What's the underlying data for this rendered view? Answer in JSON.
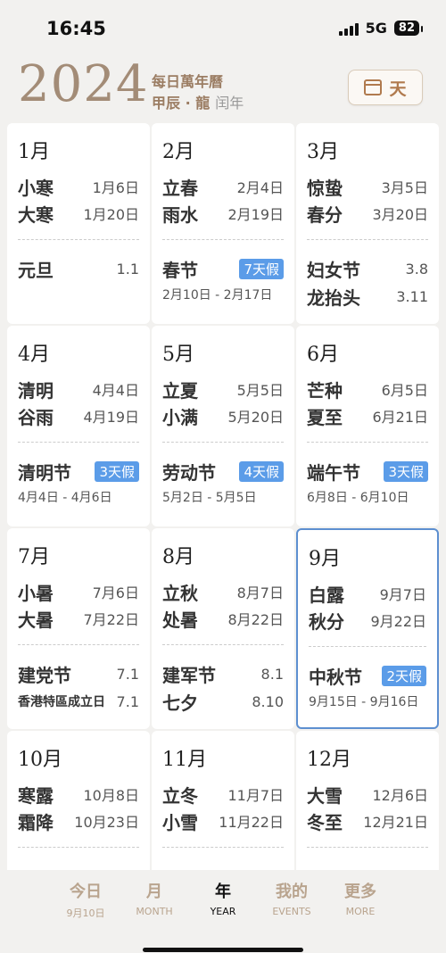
{
  "status": {
    "time": "16:45",
    "network": "5G",
    "battery": "82"
  },
  "header": {
    "year": "2024",
    "title": "每日萬年曆",
    "ganzhi": "甲辰 · 龍",
    "leap": "闰年",
    "day_button_label": "天",
    "day_button_icon": "calendar-icon"
  },
  "months": [
    {
      "month": "1月",
      "terms": [
        {
          "name": "小寒",
          "date": "1月6日"
        },
        {
          "name": "大寒",
          "date": "1月20日"
        }
      ],
      "holidays": [
        {
          "name": "元旦",
          "value": "1.1"
        }
      ]
    },
    {
      "month": "2月",
      "terms": [
        {
          "name": "立春",
          "date": "2月4日"
        },
        {
          "name": "雨水",
          "date": "2月19日"
        }
      ],
      "holidays": [
        {
          "name": "春节",
          "badge": "7天假",
          "range": "2月10日 - 2月17日"
        }
      ]
    },
    {
      "month": "3月",
      "terms": [
        {
          "name": "惊蛰",
          "date": "3月5日"
        },
        {
          "name": "春分",
          "date": "3月20日"
        }
      ],
      "holidays": [
        {
          "name": "妇女节",
          "value": "3.8"
        },
        {
          "name": "龙抬头",
          "value": "3.11"
        }
      ]
    },
    {
      "month": "4月",
      "terms": [
        {
          "name": "清明",
          "date": "4月4日"
        },
        {
          "name": "谷雨",
          "date": "4月19日"
        }
      ],
      "holidays": [
        {
          "name": "清明节",
          "badge": "3天假",
          "range": "4月4日 - 4月6日"
        }
      ]
    },
    {
      "month": "5月",
      "terms": [
        {
          "name": "立夏",
          "date": "5月5日"
        },
        {
          "name": "小满",
          "date": "5月20日"
        }
      ],
      "holidays": [
        {
          "name": "劳动节",
          "badge": "4天假",
          "range": "5月2日 - 5月5日"
        }
      ]
    },
    {
      "month": "6月",
      "terms": [
        {
          "name": "芒种",
          "date": "6月5日"
        },
        {
          "name": "夏至",
          "date": "6月21日"
        }
      ],
      "holidays": [
        {
          "name": "端午节",
          "badge": "3天假",
          "range": "6月8日 - 6月10日"
        }
      ]
    },
    {
      "month": "7月",
      "terms": [
        {
          "name": "小暑",
          "date": "7月6日"
        },
        {
          "name": "大暑",
          "date": "7月22日"
        }
      ],
      "holidays": [
        {
          "name": "建党节",
          "value": "7.1"
        },
        {
          "name": "香港特區成立日",
          "value": "7.1",
          "small": true
        }
      ]
    },
    {
      "month": "8月",
      "terms": [
        {
          "name": "立秋",
          "date": "8月7日"
        },
        {
          "name": "处暑",
          "date": "8月22日"
        }
      ],
      "holidays": [
        {
          "name": "建军节",
          "value": "8.1"
        },
        {
          "name": "七夕",
          "value": "8.10"
        }
      ]
    },
    {
      "month": "9月",
      "selected": true,
      "terms": [
        {
          "name": "白露",
          "date": "9月7日"
        },
        {
          "name": "秋分",
          "date": "9月22日"
        }
      ],
      "holidays": [
        {
          "name": "中秋节",
          "badge": "2天假",
          "range": "9月15日 - 9月16日"
        }
      ]
    },
    {
      "month": "10月",
      "terms": [
        {
          "name": "寒露",
          "date": "10月8日"
        },
        {
          "name": "霜降",
          "date": "10月23日"
        }
      ],
      "holidays": []
    },
    {
      "month": "11月",
      "terms": [
        {
          "name": "立冬",
          "date": "11月7日"
        },
        {
          "name": "小雪",
          "date": "11月22日"
        }
      ],
      "holidays": []
    },
    {
      "month": "12月",
      "terms": [
        {
          "name": "大雪",
          "date": "12月6日"
        },
        {
          "name": "冬至",
          "date": "12月21日"
        }
      ],
      "holidays": []
    }
  ],
  "tabs": [
    {
      "title": "今日",
      "sub": "9月10日"
    },
    {
      "title": "月",
      "sub": "MONTH"
    },
    {
      "title": "年",
      "sub": "YEAR",
      "active": true
    },
    {
      "title": "我的",
      "sub": "EVENTS"
    },
    {
      "title": "更多",
      "sub": "MORE"
    }
  ],
  "colors": {
    "accent": "#b07a4e",
    "badge": "#5b9ce8",
    "selected_border": "#5d8fd0",
    "year": "#a38c77"
  }
}
